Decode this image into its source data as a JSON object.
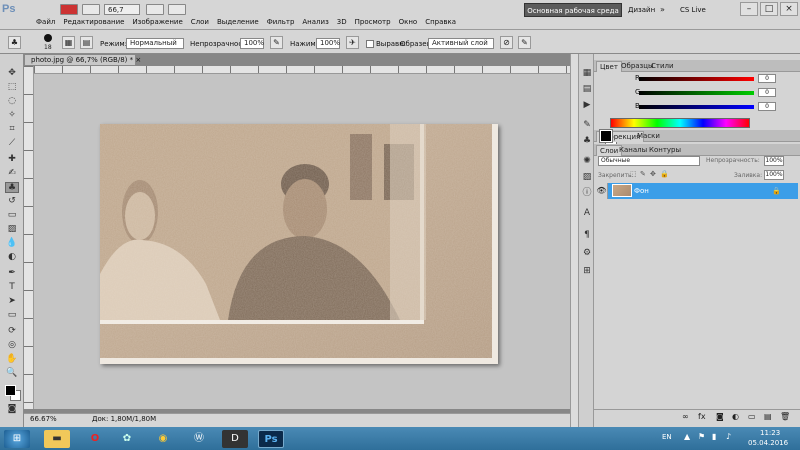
{
  "app": {
    "logo": "Ps"
  },
  "menu": [
    "Файл",
    "Редактирование",
    "Изображение",
    "Слои",
    "Выделение",
    "Фильтр",
    "Анализ",
    "3D",
    "Просмотр",
    "Окно",
    "Справка"
  ],
  "zoom_select": "66,7",
  "workspace": {
    "active": "Основная рабочая среда",
    "design": "Дизайн",
    "more": "»",
    "cs_live": "CS Live"
  },
  "options": {
    "brush_size": "18",
    "mode_label": "Режим:",
    "mode_value": "Нормальный",
    "opacity_label": "Непрозрачность:",
    "opacity_value": "100%",
    "pressure_label": "Нажим:",
    "pressure_value": "100%",
    "aligned_label": "Выравн.",
    "sample_label": "Образец:",
    "sample_value": "Активный слой"
  },
  "document": {
    "tab_title": "photo.jpg @ 66,7% (RGB/8) *",
    "zoom": "66.67%",
    "doc_info": "Док: 1,80M/1,80M"
  },
  "color_panel": {
    "tabs": [
      "Цвет",
      "Образцы",
      "Стили"
    ],
    "channels": [
      {
        "label": "R",
        "value": "0",
        "color": "#e00000"
      },
      {
        "label": "G",
        "value": "0",
        "color": "#00b000"
      },
      {
        "label": "B",
        "value": "0",
        "color": "#0000e0"
      }
    ]
  },
  "adjust_tabs": [
    "Коррекция",
    "Маски"
  ],
  "layers_panel": {
    "tabs": [
      "Слои",
      "Каналы",
      "Контуры"
    ],
    "blend_mode": "Обычные",
    "opacity_label": "Непрозрачность:",
    "opacity_value": "100%",
    "lock_label": "Закрепить:",
    "fill_label": "Заливка:",
    "fill_value": "100%",
    "layers": [
      {
        "name": "Фон",
        "locked": true
      }
    ]
  },
  "taskbar": {
    "lang": "EN",
    "time": "11:23",
    "date": "05.04.2016"
  },
  "colors": {
    "accent": "#3b9ee8",
    "taskbar": "#2f6f9a"
  }
}
